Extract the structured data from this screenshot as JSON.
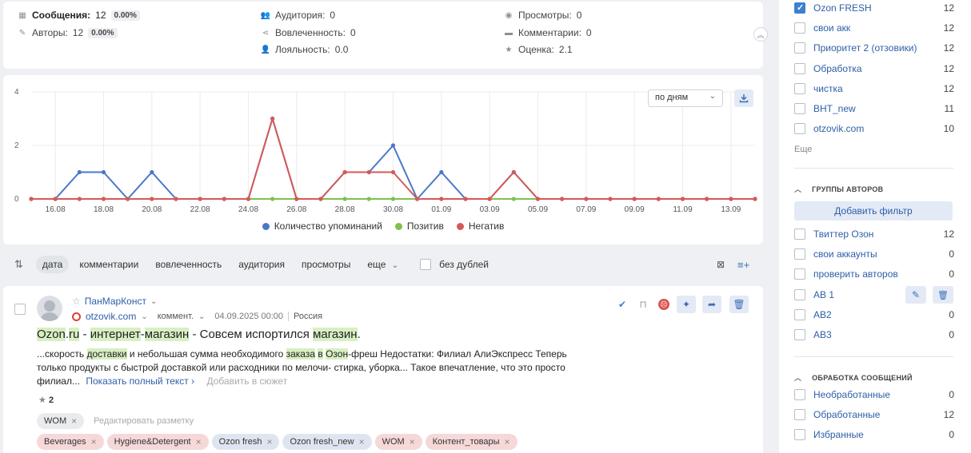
{
  "stats": {
    "messages_label": "Сообщения:",
    "messages_value": "12",
    "messages_pct": "0.00%",
    "authors_label": "Авторы:",
    "authors_value": "12",
    "authors_pct": "0.00%",
    "audience_label": "Аудитория:",
    "audience_value": "0",
    "engagement_label": "Вовлеченность:",
    "engagement_value": "0",
    "loyalty_label": "Лояльность:",
    "loyalty_value": "0.0",
    "views_label": "Просмотры:",
    "views_value": "0",
    "comments_label": "Комментарии:",
    "comments_value": "0",
    "rating_label": "Оценка:",
    "rating_value": "2.1"
  },
  "chart_controls": {
    "period": "по дням"
  },
  "chart_data": {
    "type": "line",
    "x": [
      "15.08",
      "16.08",
      "17.08",
      "18.08",
      "19.08",
      "20.08",
      "21.08",
      "22.08",
      "23.08",
      "24.08",
      "25.08",
      "26.08",
      "27.08",
      "28.08",
      "29.08",
      "30.08",
      "31.08",
      "01.09",
      "02.09",
      "03.09",
      "04.09",
      "05.09",
      "06.09",
      "07.09",
      "08.09",
      "09.09",
      "10.09",
      "11.09",
      "12.09",
      "13.09",
      "14.09"
    ],
    "x_tick_labels": [
      "16.08",
      "18.08",
      "20.08",
      "22.08",
      "24.08",
      "26.08",
      "28.08",
      "30.08",
      "01.09",
      "03.09",
      "05.09",
      "07.09",
      "09.09",
      "11.09",
      "13.09"
    ],
    "y_ticks": [
      "0",
      "2",
      "4"
    ],
    "ylim": [
      0,
      4
    ],
    "series": [
      {
        "name": "Количество упоминаний",
        "color": "#4a78c8",
        "values": [
          0,
          0,
          1,
          1,
          0,
          1,
          0,
          0,
          0,
          0,
          3,
          0,
          0,
          1,
          1,
          2,
          0,
          1,
          0,
          0,
          1,
          0,
          0,
          0,
          0,
          0,
          0,
          0,
          0,
          0,
          0
        ]
      },
      {
        "name": "Позитив",
        "color": "#7ec14f",
        "values": [
          0,
          0,
          0,
          0,
          0,
          0,
          0,
          0,
          0,
          0,
          0,
          0,
          0,
          0,
          0,
          0,
          0,
          0,
          0,
          0,
          0,
          0,
          0,
          0,
          0,
          0,
          0,
          0,
          0,
          0,
          0
        ]
      },
      {
        "name": "Негатив",
        "color": "#d45a5a",
        "values": [
          0,
          0,
          0,
          0,
          0,
          0,
          0,
          0,
          0,
          0,
          3,
          0,
          0,
          1,
          1,
          1,
          0,
          0,
          0,
          0,
          1,
          0,
          0,
          0,
          0,
          0,
          0,
          0,
          0,
          0,
          0
        ]
      }
    ]
  },
  "sortbar": {
    "items": [
      "дата",
      "комментарии",
      "вовлеченность",
      "аудитория",
      "просмотры",
      "еще"
    ],
    "nodup_label": "без дублей"
  },
  "post": {
    "author": "ПанМарКонст",
    "source": "otzovik.com",
    "type": "коммент.",
    "datetime": "04.09.2025 00:00",
    "country": "Россия",
    "title_parts": [
      "Ozon",
      ".",
      "ru",
      " - ",
      "интернет",
      "-",
      "магазин",
      " - Совсем испортился ",
      "магазин",
      "."
    ],
    "body_1": "...скорость ",
    "body_hl_1": "доставки",
    "body_2": " и небольшая сумма необходимого ",
    "body_hl_2": "заказа",
    "body_3": " ",
    "body_hl_3": "в",
    "body_4": " ",
    "body_hl_4": "Озон",
    "body_5": "-фреш Недостатки: Филиал АлиЭкспресс Теперь только продукты с быстрой доставкой или расходники по мелочи- стирка, уборка... Такое впечатление, что это просто филиал...",
    "show_full": "Показать полный текст ›",
    "add_to_story": "Добавить в сюжет",
    "stars": "2",
    "markup_tag": "WOM",
    "edit_markup": "Редактировать разметку",
    "tags": [
      {
        "label": "Beverages",
        "style": "red"
      },
      {
        "label": "Hygiene&Detergent",
        "style": "red"
      },
      {
        "label": "Ozon fresh",
        "style": "blue"
      },
      {
        "label": "Ozon fresh_new",
        "style": "blue"
      },
      {
        "label": "WOM",
        "style": "red"
      },
      {
        "label": "Контент_товары",
        "style": "red"
      }
    ]
  },
  "sidebar": {
    "sources": [
      {
        "label": "Ozon FRESH",
        "count": "12",
        "checked": true
      },
      {
        "label": "свои акк",
        "count": "12"
      },
      {
        "label": "Приоритет 2 (отзовики)",
        "count": "12"
      },
      {
        "label": "Обработка",
        "count": "12"
      },
      {
        "label": "чистка",
        "count": "12"
      },
      {
        "label": "ВНТ_new",
        "count": "11"
      },
      {
        "label": "otzovik.com",
        "count": "10"
      }
    ],
    "more_label": "Еще",
    "author_groups_title": "ГРУППЫ АВТОРОВ",
    "add_filter_label": "Добавить фильтр",
    "author_groups": [
      {
        "label": "Твиттер Озон",
        "count": "12"
      },
      {
        "label": "свои аккаунты",
        "count": "0"
      },
      {
        "label": "проверить авторов",
        "count": "0"
      },
      {
        "label": "АВ 1",
        "count": ""
      },
      {
        "label": "АВ2",
        "count": "0"
      },
      {
        "label": "АВ3",
        "count": "0"
      }
    ],
    "processing_title": "ОБРАБОТКА СООБЩЕНИЙ",
    "processing": [
      {
        "label": "Необработанные",
        "count": "0"
      },
      {
        "label": "Обработанные",
        "count": "12"
      },
      {
        "label": "Избранные",
        "count": "0"
      }
    ]
  }
}
